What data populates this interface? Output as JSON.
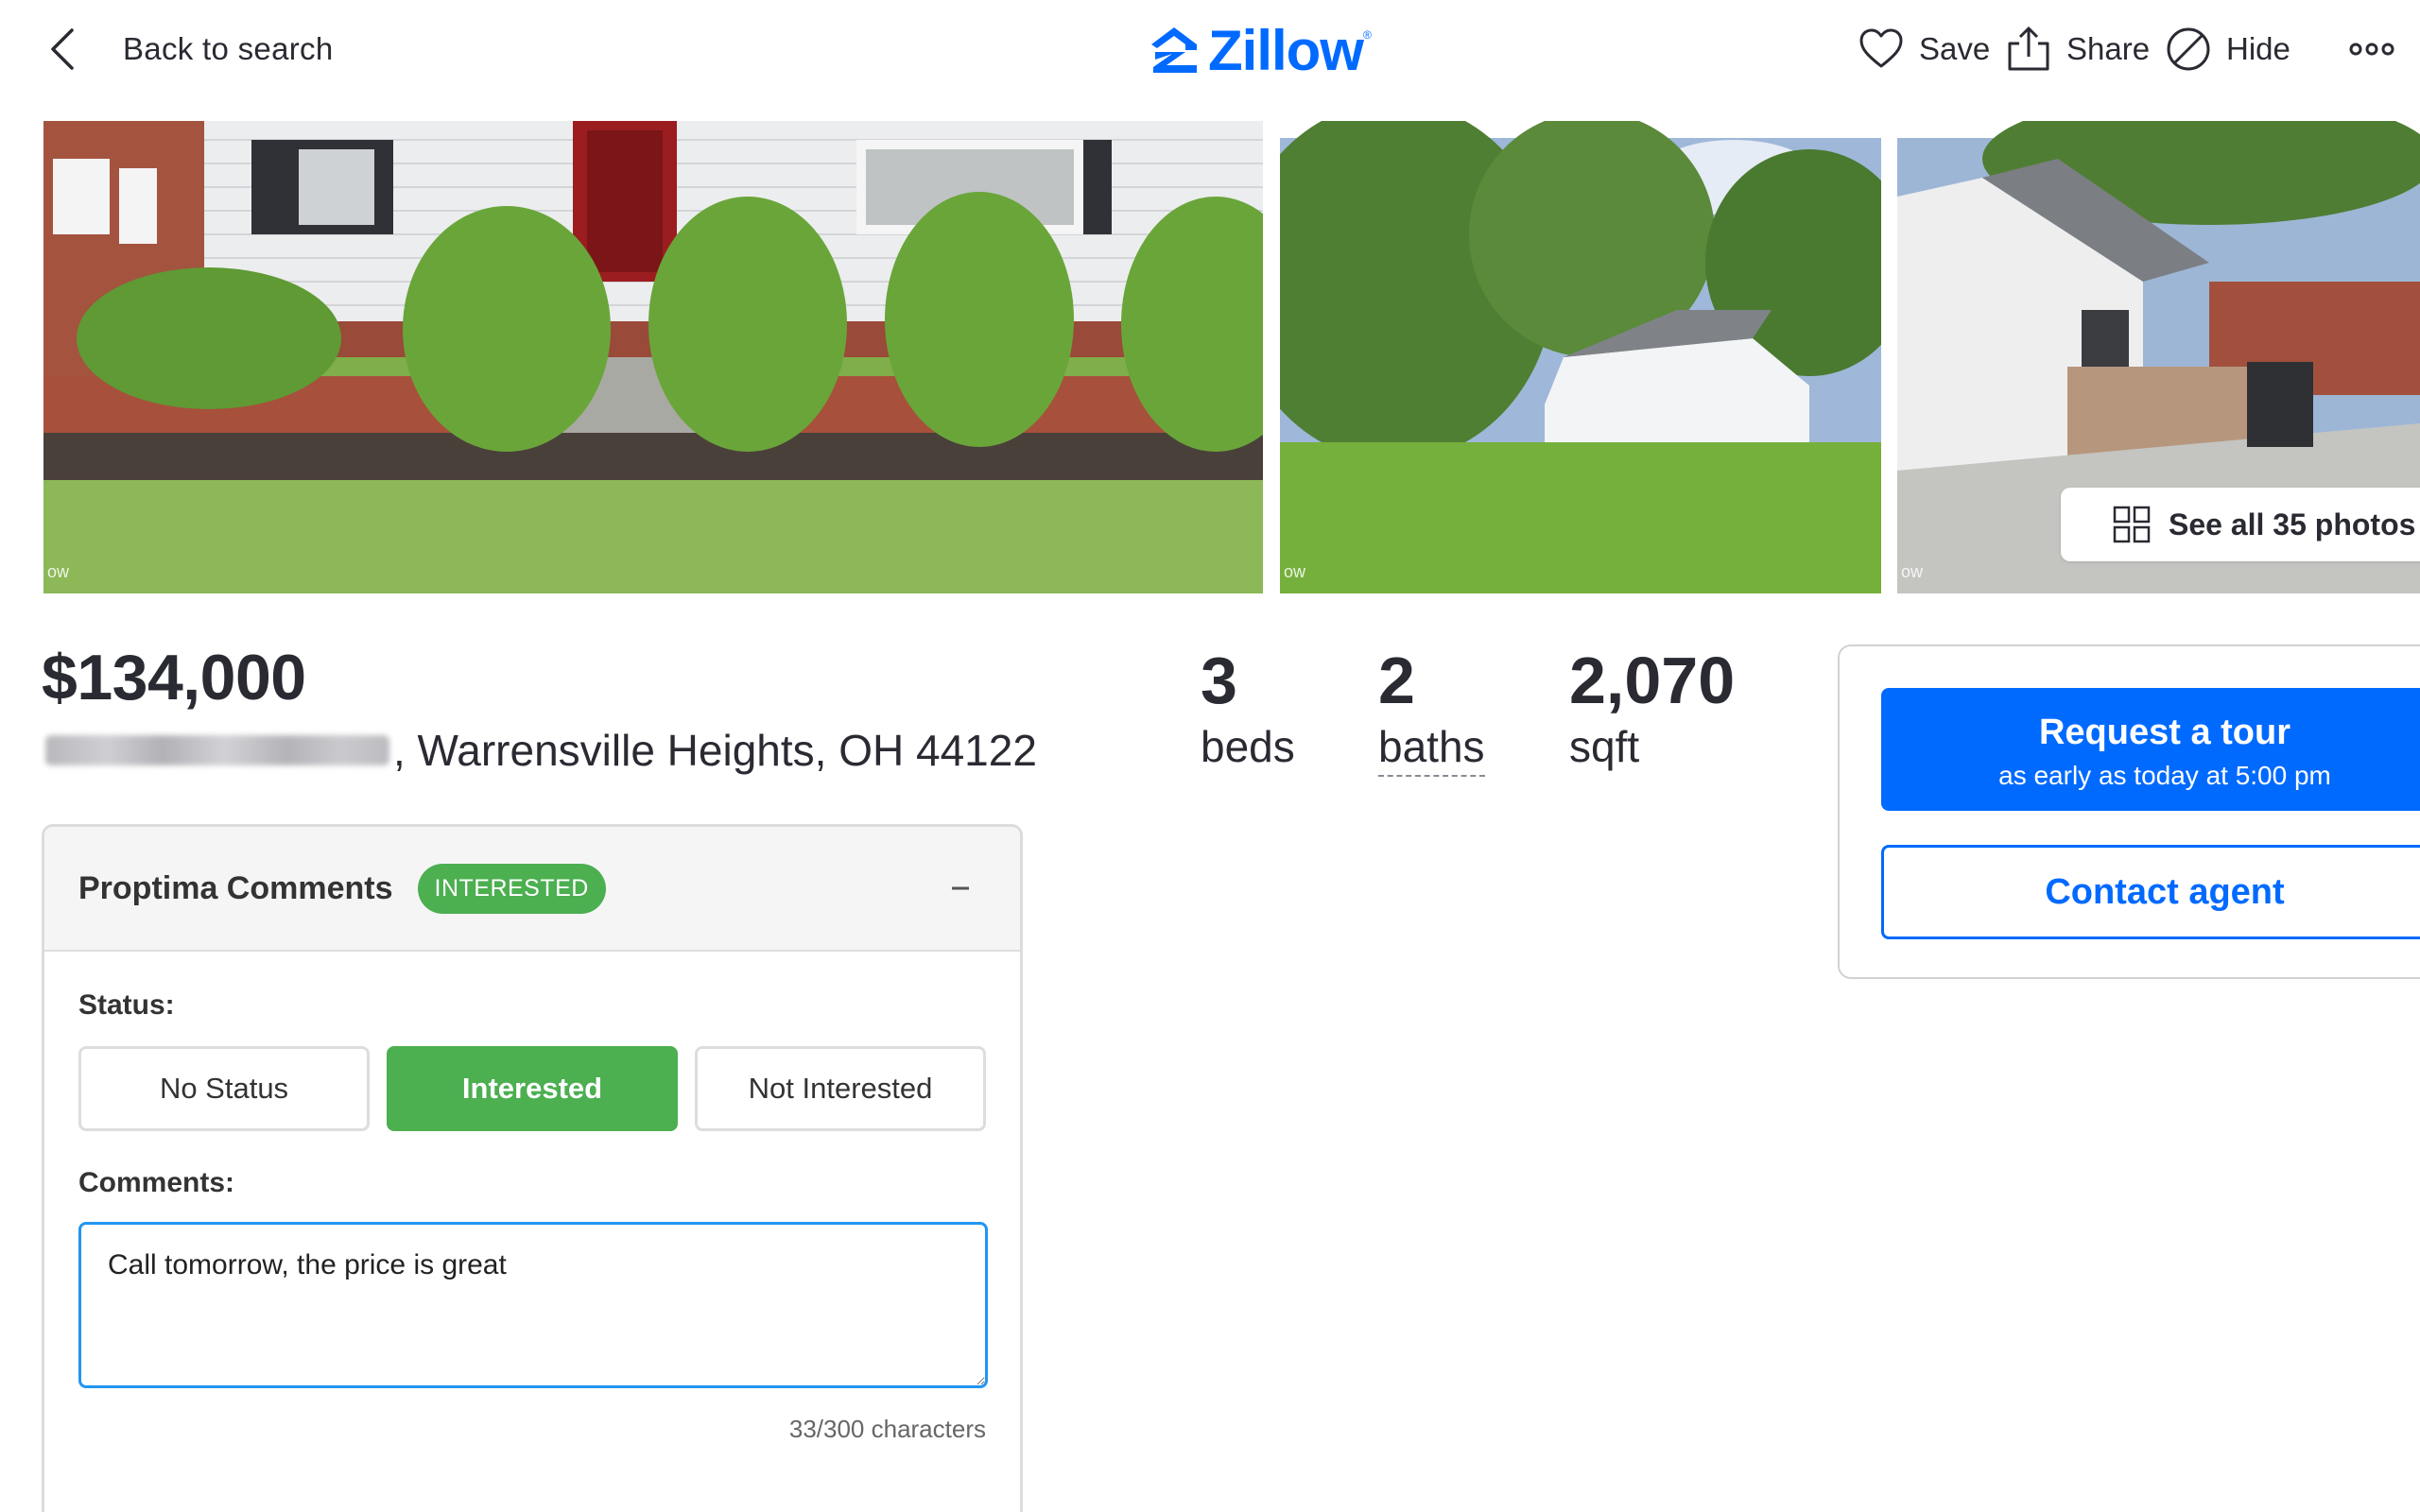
{
  "topbar": {
    "back_label": "Back to search",
    "logo_text": "Zillow",
    "logo_mark": "®",
    "actions": {
      "save": "Save",
      "share": "Share",
      "hide": "Hide"
    }
  },
  "photos": {
    "see_all_label": "See all 35 photos",
    "watermark": "ow"
  },
  "listing": {
    "price": "$134,000",
    "address_city": ", Warrensville Heights, OH 44122",
    "facts": {
      "beds_value": "3",
      "beds_label": "beds",
      "baths_value": "2",
      "baths_label": "baths",
      "sqft_value": "2,070",
      "sqft_label": "sqft"
    }
  },
  "contact": {
    "tour_title": "Request a tour",
    "tour_subtitle": "as early as today at 5:00 pm",
    "contact_agent": "Contact agent"
  },
  "comments_panel": {
    "title": "Proptima Comments",
    "badge": "INTERESTED",
    "status_label": "Status:",
    "status_options": [
      "No Status",
      "Interested",
      "Not Interested"
    ],
    "selected_status": "Interested",
    "comments_label": "Comments:",
    "comment_value": "Call tomorrow, the price is great",
    "char_count": "33/300 characters"
  },
  "colors": {
    "brand_blue": "#006aff",
    "status_green": "#4caf50",
    "focus_blue": "#2196f3",
    "text_dark": "#2a2a33"
  },
  "icons": [
    "chevron-left-icon",
    "zillow-logo-icon",
    "heart-icon",
    "share-icon",
    "hide-icon",
    "more-icon",
    "grid-icon",
    "minus-icon"
  ]
}
